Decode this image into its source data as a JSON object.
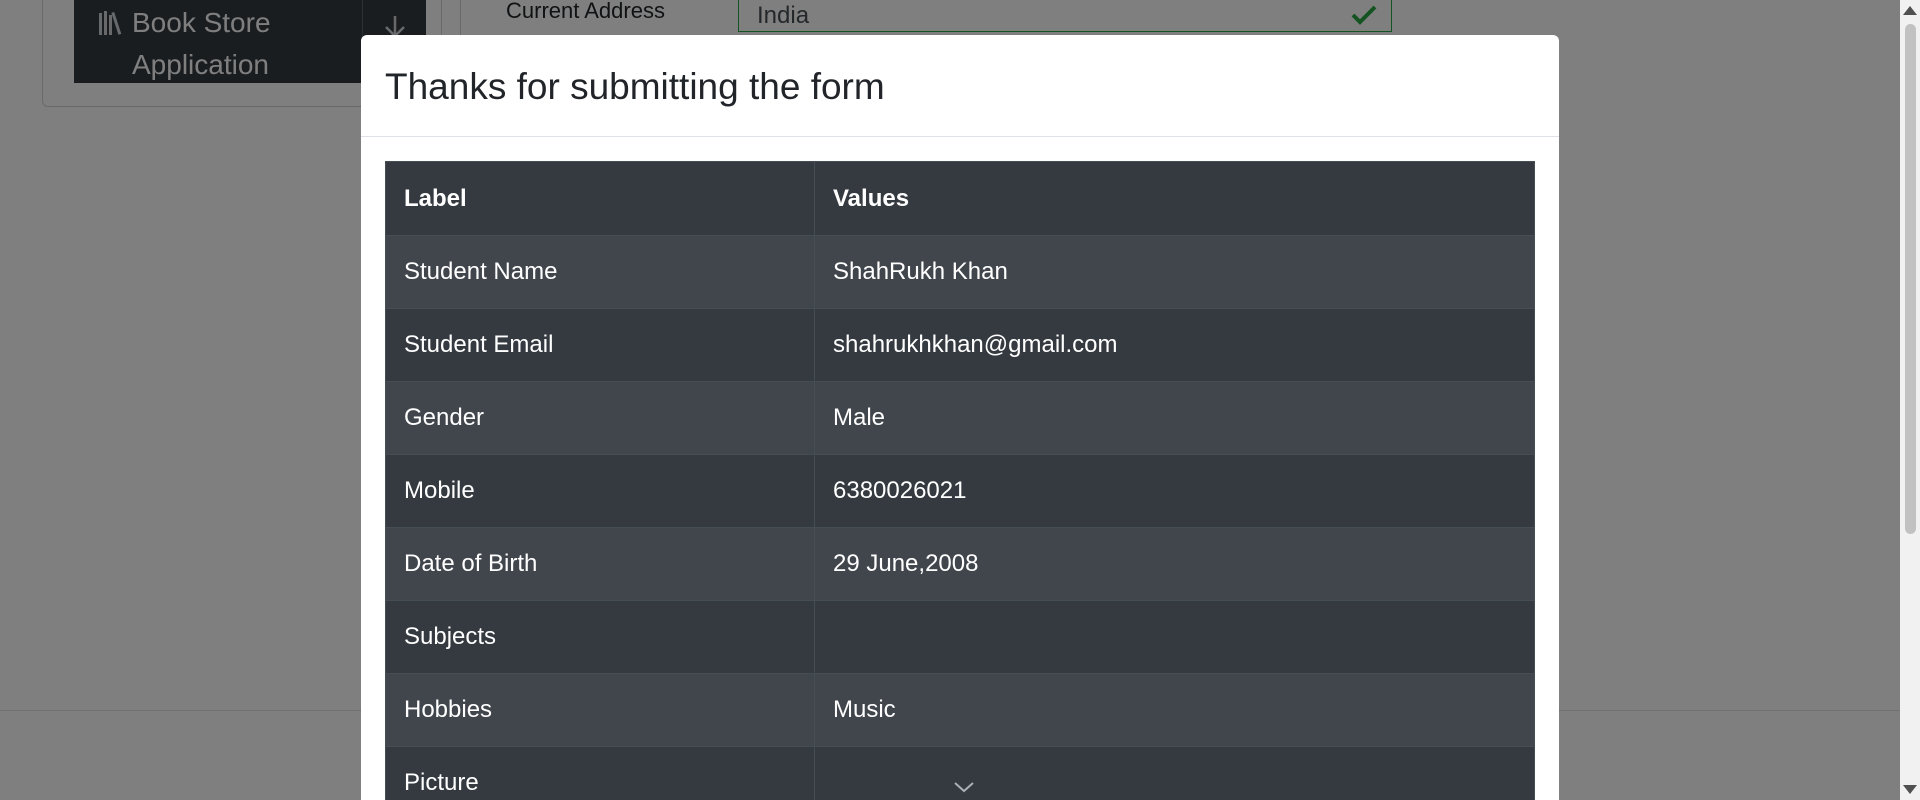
{
  "background": {
    "menu": {
      "title": "Book Store Application",
      "icon": "books-icon",
      "toggle_icon": "arrow-down-icon"
    },
    "form": {
      "current_address_label": "Current Address",
      "current_address_value": "India"
    }
  },
  "modal": {
    "title": "Thanks for submitting the form",
    "table": {
      "headers": {
        "label": "Label",
        "values": "Values"
      },
      "rows": [
        {
          "label": "Student Name",
          "value": "ShahRukh Khan"
        },
        {
          "label": "Student Email",
          "value": "shahrukhkhan@gmail.com"
        },
        {
          "label": "Gender",
          "value": "Male"
        },
        {
          "label": "Mobile",
          "value": "6380026021"
        },
        {
          "label": "Date of Birth",
          "value": "29 June,2008"
        },
        {
          "label": "Subjects",
          "value": ""
        },
        {
          "label": "Hobbies",
          "value": "Music"
        },
        {
          "label": "Picture",
          "value": ""
        }
      ]
    }
  },
  "colors": {
    "table_dark": "#343a40",
    "table_stripe": "#41464d",
    "valid_green": "#28a745",
    "overlay": "rgba(0,0,0,0.5)"
  }
}
